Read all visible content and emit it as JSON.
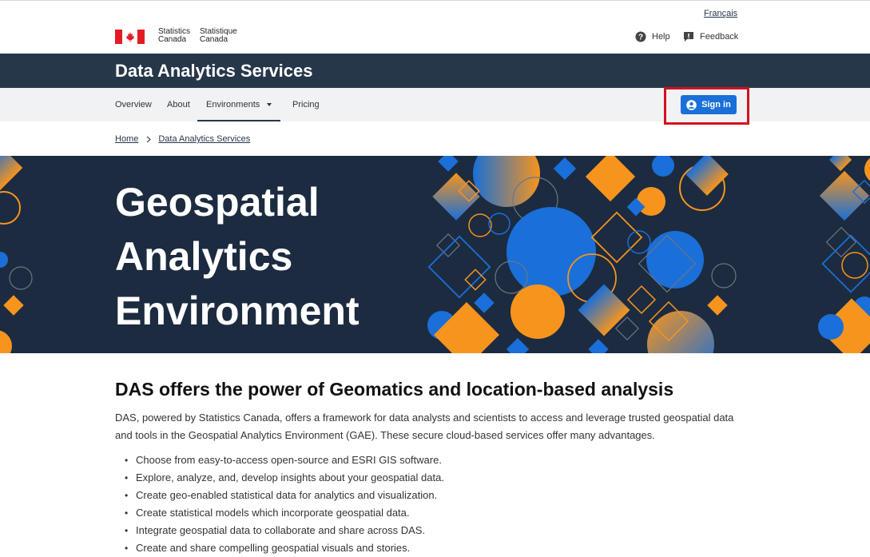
{
  "header": {
    "language_link": "Français",
    "wordmark_en": [
      "Statistics",
      "Canada"
    ],
    "wordmark_fr": [
      "Statistique",
      "Canada"
    ],
    "help_label": "Help",
    "feedback_label": "Feedback",
    "help_icon": "question-circle-icon",
    "feedback_icon": "feedback-icon"
  },
  "app": {
    "title": "Data Analytics Services"
  },
  "menu": {
    "items": [
      "Overview",
      "About",
      "Environments",
      "Pricing"
    ],
    "signin_label": "Sign in",
    "signin_icon": "user-circle-icon"
  },
  "breadcrumb": [
    "Home",
    "Data Analytics Services"
  ],
  "hero": {
    "title_lines": [
      "Geospatial",
      "Analytics",
      "Environment"
    ]
  },
  "main": {
    "heading": "DAS offers the power of Geomatics and location-based analysis",
    "intro": "DAS, powered by Statistics Canada, offers a framework for data analysts and scientists to access and leverage trusted geospatial data and tools in the Geospatial Analytics Environment (GAE). These secure cloud-based services offer many advantages.",
    "bullets": [
      "Choose from easy-to-access open-source and ESRI GIS software.",
      "Explore, analyze, and, develop insights about your geospatial data.",
      "Create geo-enabled statistical data for analytics and visualization.",
      "Create statistical models which incorporate geospatial data.",
      "Integrate geospatial data to collaborate and share across DAS.",
      "Create and share compelling geospatial visuals and stories."
    ]
  },
  "colors": {
    "navy": "#26374a",
    "hero_bg": "#1c2b40",
    "accent_blue": "#1a6fd8",
    "accent_orange": "#f7941d",
    "highlight_red": "#d3121e"
  }
}
